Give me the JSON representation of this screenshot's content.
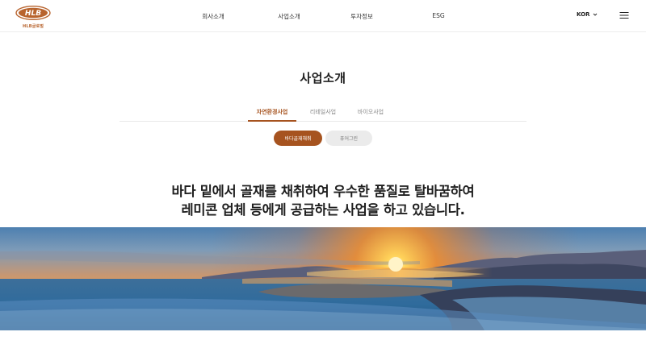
{
  "header": {
    "logo": {
      "mark_text": "HLB",
      "sub_text": "HLB글로벌"
    },
    "nav": [
      {
        "label": "회사소개"
      },
      {
        "label": "사업소개"
      },
      {
        "label": "투자정보"
      },
      {
        "label": "ESG"
      }
    ],
    "language": "KOR",
    "icons": {
      "language_caret": "chevron-down-icon",
      "menu": "hamburger-menu-icon"
    }
  },
  "page_title": "사업소개",
  "tabs": [
    {
      "label": "자연환경사업",
      "active": true
    },
    {
      "label": "리테일사업",
      "active": false
    },
    {
      "label": "바이오사업",
      "active": false
    }
  ],
  "sub_tabs": [
    {
      "label": "바다골재채취",
      "active": true
    },
    {
      "label": "퓨어그린",
      "active": false
    }
  ],
  "headline": {
    "line1": "바다 밑에서 골재를 채취하여 우수한 품질로 탈바꿈하여",
    "line2": "레미콘 업체 등에게 공급하는 사업을 하고 있습니다."
  },
  "colors": {
    "brand": "#a6531f",
    "text": "#222222",
    "inactive_pill": "#ebebeb"
  },
  "hero_image": {
    "subject": "sunrise-over-sea-landscape"
  }
}
